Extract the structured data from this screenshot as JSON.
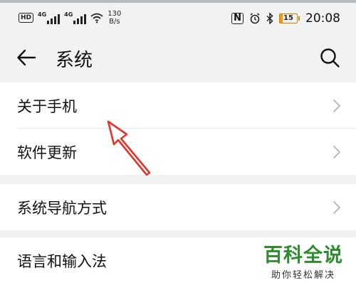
{
  "status_bar": {
    "hd_label": "HD",
    "network_label": "4G",
    "speed_value": "130",
    "speed_unit": "B/s",
    "nfc_label": "N",
    "battery_level": "15",
    "time": "20:08",
    "battery_color": "#f59a00"
  },
  "header": {
    "title": "系统",
    "back_icon": "arrow-left-icon",
    "search_icon": "search-icon"
  },
  "groups": [
    {
      "items": [
        {
          "label": "关于手机"
        },
        {
          "label": "软件更新"
        }
      ]
    },
    {
      "items": [
        {
          "label": "系统导航方式"
        }
      ]
    },
    {
      "items": [
        {
          "label": "语言和输入法"
        }
      ]
    }
  ],
  "watermark": {
    "title": "百科全说",
    "subtitle": "助你轻松解决",
    "color": "#2e8b2e"
  },
  "annotation": {
    "arrow_color": "#e0352b"
  }
}
